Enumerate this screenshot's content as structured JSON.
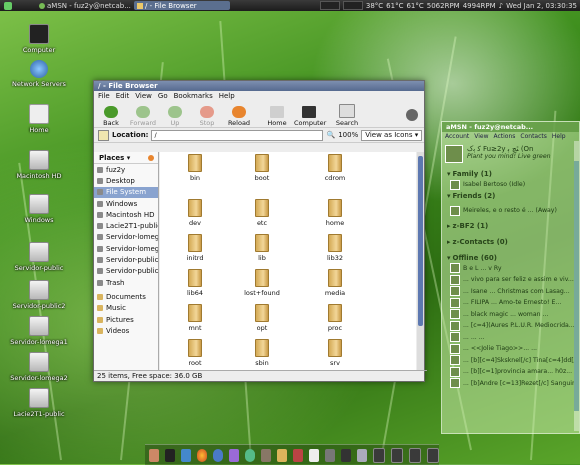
{
  "top_panel": {
    "tasks": [
      {
        "label": "aMSN - fuz2y@netcab..."
      },
      {
        "label": "/ - File Browser"
      }
    ],
    "temps": [
      "38°C",
      "61°C",
      "61°C"
    ],
    "fan1": "5062RPM",
    "fan2": "4994RPM",
    "clock": "Wed Jan  2, 03:30:35"
  },
  "desktop_icons": [
    {
      "label": "Computer",
      "icon": "computer-icon"
    },
    {
      "label": "Network Servers",
      "icon": "network-icon"
    },
    {
      "label": "Home",
      "icon": "home-icon"
    },
    {
      "label": "Macintosh HD",
      "icon": "drive-icon"
    },
    {
      "label": "Windows",
      "icon": "drive-icon"
    },
    {
      "label": "Servidor-public",
      "icon": "drive-icon"
    },
    {
      "label": "Servidor-public2",
      "icon": "drive-icon"
    },
    {
      "label": "Servidor-lomega1",
      "icon": "drive-icon"
    },
    {
      "label": "Servidor-lomega2",
      "icon": "drive-icon"
    },
    {
      "label": "Lacie2T1-public",
      "icon": "drive-icon"
    }
  ],
  "file_browser": {
    "title": "/ - File Browser",
    "menu": [
      "File",
      "Edit",
      "View",
      "Go",
      "Bookmarks",
      "Help"
    ],
    "toolbar": [
      {
        "label": "Back",
        "enabled": true
      },
      {
        "label": "Forward",
        "enabled": false
      },
      {
        "label": "Up",
        "enabled": false
      },
      {
        "label": "Stop",
        "enabled": false
      },
      {
        "label": "Reload",
        "enabled": true
      },
      {
        "label": "Home",
        "enabled": true
      },
      {
        "label": "Computer",
        "enabled": true
      },
      {
        "label": "Search",
        "enabled": true
      }
    ],
    "location_label": "Location:",
    "location_value": "/",
    "zoom": "100%",
    "view_mode": "View as Icons",
    "places_label": "Places",
    "places": [
      {
        "label": "fuz2y"
      },
      {
        "label": "Desktop"
      },
      {
        "label": "File System",
        "selected": true
      },
      {
        "label": "Windows"
      },
      {
        "label": "Macintosh HD"
      },
      {
        "label": "Lacie2T1-public"
      },
      {
        "label": "Servidor-lomega1"
      },
      {
        "label": "Servidor-lomega2"
      },
      {
        "label": "Servidor-public"
      },
      {
        "label": "Servidor-public2"
      },
      {
        "label": "Trash"
      },
      {
        "label": "Documents"
      },
      {
        "label": "Music"
      },
      {
        "label": "Pictures"
      },
      {
        "label": "Videos"
      }
    ],
    "files": [
      "bin",
      "boot",
      "cdrom",
      "dev",
      "etc",
      "home",
      "initrd",
      "lib",
      "lib32",
      "lib64",
      "lost+found",
      "media",
      "mnt",
      "opt",
      "proc",
      "root",
      "sbin",
      "srv"
    ],
    "status": "25 items, Free space: 36.0 GB"
  },
  "amsn": {
    "title": "aMSN - fuz2y@netcab...",
    "menu": [
      "Account",
      "View",
      "Actions",
      "Contacts",
      "Help"
    ],
    "nick": "ﮐ ﯦﮎ Fu≥2y ﭥﭻ ﯦ (On",
    "status_msg": "Plant you mind! Live green",
    "groups": [
      {
        "label": "Family (1)",
        "contacts": [
          "Isabel Bertoso (Idle)"
        ]
      },
      {
        "label": "Friends (2)",
        "contacts": [
          "Meireles, e o resto é ... (Away)"
        ]
      },
      {
        "label": "z-BF2 (1)",
        "contacts": []
      },
      {
        "label": "z-Contacts (0)",
        "contacts": []
      },
      {
        "label": "Offline (60)",
        "contacts": [
          "B e L ...  v Ry",
          "... vivo para ser feliz e assim e viv...",
          "... Isane ... Christmas com Lasag...",
          "... FILIPA ... Amo-te Ernesto! E...",
          "... black magic ... woman ...",
          "... [c=4](Aures P.L.U.R. Mediocrida...",
          "... ... ...",
          "... <<Jolie Tiago>>... ...",
          "... [b][c=4]Sksknel[/c] Tina[c=4]dd[/c...",
          "... [b][c=1]provincia amara... h0z...",
          "... [b]Andre [c=13]Rezet[/c] Sanguino..."
        ]
      }
    ]
  },
  "dock_items": [
    "app-1",
    "terminal",
    "network",
    "firefox",
    "thunderbird",
    "pidgin",
    "messenger",
    "gimp",
    "files",
    "games",
    "calendar",
    "settings",
    "disk",
    "trash",
    "workspace-1",
    "workspace-2",
    "workspace-3",
    "workspace-4"
  ]
}
